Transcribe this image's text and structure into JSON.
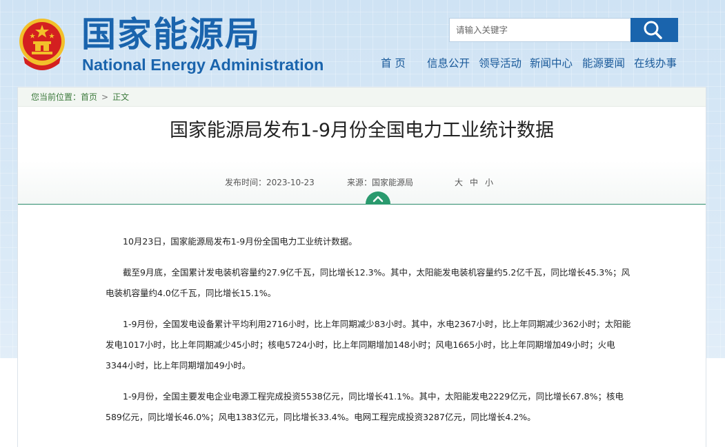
{
  "header": {
    "brand_cn": "国家能源局",
    "brand_en": "National Energy Administration",
    "search_placeholder": "请输入关键字",
    "nav": [
      "首 页",
      "信息公开",
      "领导活动",
      "新闻中心",
      "能源要闻",
      "在线办事"
    ]
  },
  "colors": {
    "brand_blue": "#1a64ad",
    "accent_green": "#2a9a6e",
    "emblem_red": "#d42020",
    "emblem_gold": "#f2c02a"
  },
  "breadcrumb": {
    "prefix": "您当前位置：",
    "items": [
      "首页",
      "正文"
    ],
    "separator": ">"
  },
  "article": {
    "title": "国家能源局发布1-9月份全国电力工业统计数据",
    "publish_label": "发布时间：",
    "publish_date": "2023-10-23",
    "source_label": "来源：",
    "source": "国家能源局",
    "font_sizes": [
      "大",
      "中",
      "小"
    ],
    "paragraphs": [
      "10月23日，国家能源局发布1-9月份全国电力工业统计数据。",
      "截至9月底，全国累计发电装机容量约27.9亿千瓦，同比增长12.3%。其中，太阳能发电装机容量约5.2亿千瓦，同比增长45.3%；风电装机容量约4.0亿千瓦，同比增长15.1%。",
      "1-9月份，全国发电设备累计平均利用2716小时，比上年同期减少83小时。其中，水电2367小时，比上年同期减少362小时；太阳能发电1017小时，比上年同期减少45小时；核电5724小时，比上年同期增加148小时；风电1665小时，比上年同期增加49小时；火电3344小时，比上年同期增加49小时。",
      "1-9月份，全国主要发电企业电源工程完成投资5538亿元，同比增长41.1%。其中，太阳能发电2229亿元，同比增长67.8%；核电589亿元，同比增长46.0%；风电1383亿元，同比增长33.4%。电网工程完成投资3287亿元，同比增长4.2%。"
    ]
  }
}
